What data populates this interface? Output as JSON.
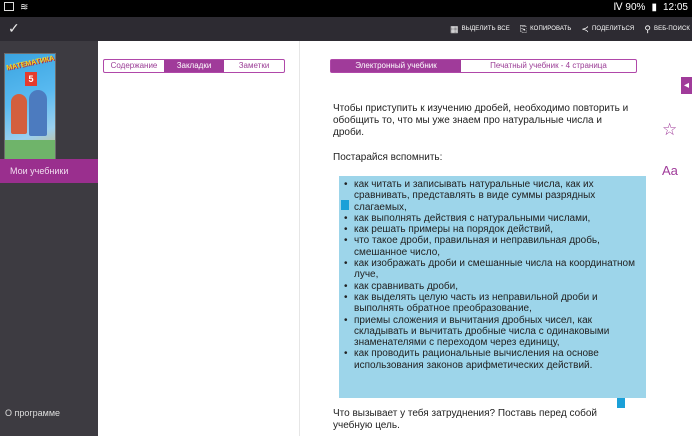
{
  "status_bar": {
    "signal": "Ⅳ 90%",
    "time": "12:05"
  },
  "action_bar": {
    "confirm": "✓",
    "actions": [
      {
        "icon": "select-all-icon",
        "glyph": "▦",
        "label": "выделить все"
      },
      {
        "icon": "copy-icon",
        "glyph": "⎘",
        "label": "копировать"
      },
      {
        "icon": "share-icon",
        "glyph": "≺",
        "label": "поделиться"
      },
      {
        "icon": "search-icon",
        "glyph": "⚲",
        "label": "веб-поиск"
      }
    ]
  },
  "sidebar": {
    "book_cover": {
      "title": "МАТЕМАТИКА",
      "grade": "5"
    },
    "my_books": "Мои учебники",
    "about": "О программе"
  },
  "left_tabs": {
    "contents": "Содержание",
    "bookmarks": "Закладки",
    "notes": "Заметки"
  },
  "right_tabs": {
    "electronic": "Электронный учебник",
    "print": "Печатный учебник - 4 страница"
  },
  "tools": {
    "back": "◂",
    "star": "☆",
    "font": "Aa"
  },
  "content": {
    "paragraph1": "Чтобы приступить к изучению дробей, необходимо повторить и обобщить то, что мы уже знаем про натуральные числа и дроби.",
    "paragraph2": "Постарайся вспомнить:",
    "list": [
      "как читать и записывать натуральные числа, как их сравнивать, представлять в виде суммы разрядных слагаемых,",
      "как выполнять действия с натуральными числами,",
      "как решать примеры на порядок действий,",
      "что такое дроби, правильная и неправильная дробь, смешанное число,",
      "как изображать дроби и смешанные числа на координатном луче,",
      "как сравнивать дроби,",
      "как выделять целую часть из неправильной дроби и выполнять обратное преобразование,",
      "приемы сложения и вычитания дробных чисел, как складывать и вычитать дробные числа с одинаковыми знаменателями с переходом через единицу,",
      "как проводить рациональные вычисления на основе использования законов арифметических действий."
    ],
    "paragraph3": "Что вызывает у тебя затруднения? Поставь перед собой учебную цель."
  }
}
